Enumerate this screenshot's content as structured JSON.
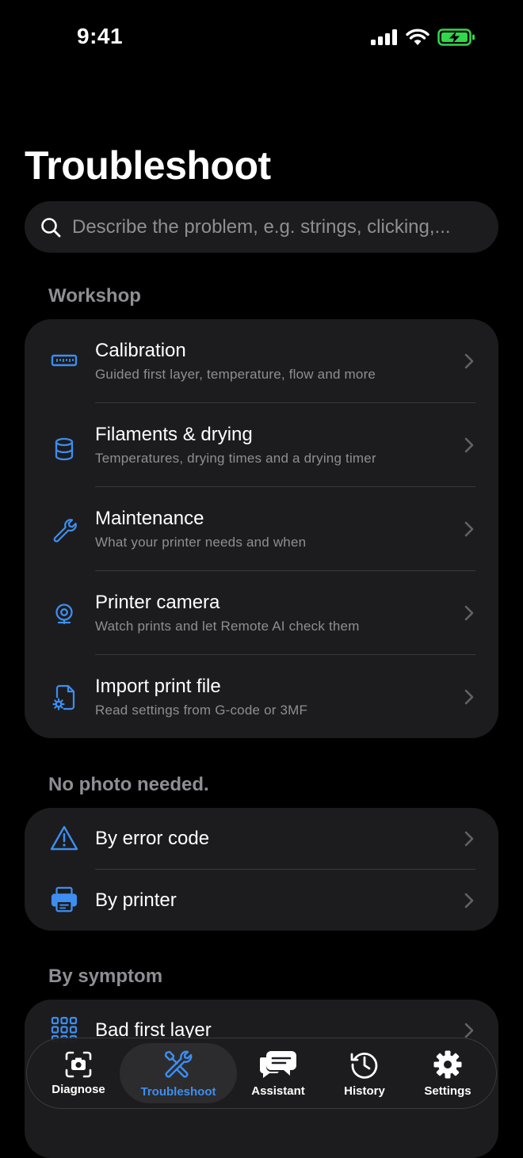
{
  "status": {
    "time": "9:41"
  },
  "header": {
    "title": "Troubleshoot"
  },
  "search": {
    "placeholder": "Describe the problem, e.g. strings, clicking,..."
  },
  "sections": {
    "workshop": "Workshop",
    "no_photo": "No photo needed.",
    "by_symptom": "By symptom"
  },
  "workshop_items": [
    {
      "icon": "ruler-icon",
      "title": "Calibration",
      "subtitle": "Guided first layer, temperature, flow and more"
    },
    {
      "icon": "spool-icon",
      "title": "Filaments & drying",
      "subtitle": "Temperatures, drying times and a drying timer"
    },
    {
      "icon": "wrench-icon",
      "title": "Maintenance",
      "subtitle": "What your printer needs and when"
    },
    {
      "icon": "camera-icon",
      "title": "Printer camera",
      "subtitle": "Watch prints and let Remote AI check them"
    },
    {
      "icon": "file-gear-icon",
      "title": "Import print file",
      "subtitle": "Read settings from G-code or 3MF"
    }
  ],
  "no_photo_items": [
    {
      "icon": "warning-icon",
      "title": "By error code"
    },
    {
      "icon": "printer-icon",
      "title": "By printer"
    }
  ],
  "symptom_items": [
    {
      "icon": "grid-icon",
      "title": "Bad first layer"
    }
  ],
  "tabs": [
    {
      "icon": "camera-frame-icon",
      "label": "Diagnose"
    },
    {
      "icon": "tools-icon",
      "label": "Troubleshoot",
      "active": true
    },
    {
      "icon": "chat-icon",
      "label": "Assistant"
    },
    {
      "icon": "history-icon",
      "label": "History"
    },
    {
      "icon": "gear-icon",
      "label": "Settings"
    }
  ],
  "colors": {
    "accent": "#3d8ef0",
    "background": "#000000",
    "card": "#1c1c1e",
    "secondary_text": "#8e8e93",
    "battery": "#32d74b"
  }
}
